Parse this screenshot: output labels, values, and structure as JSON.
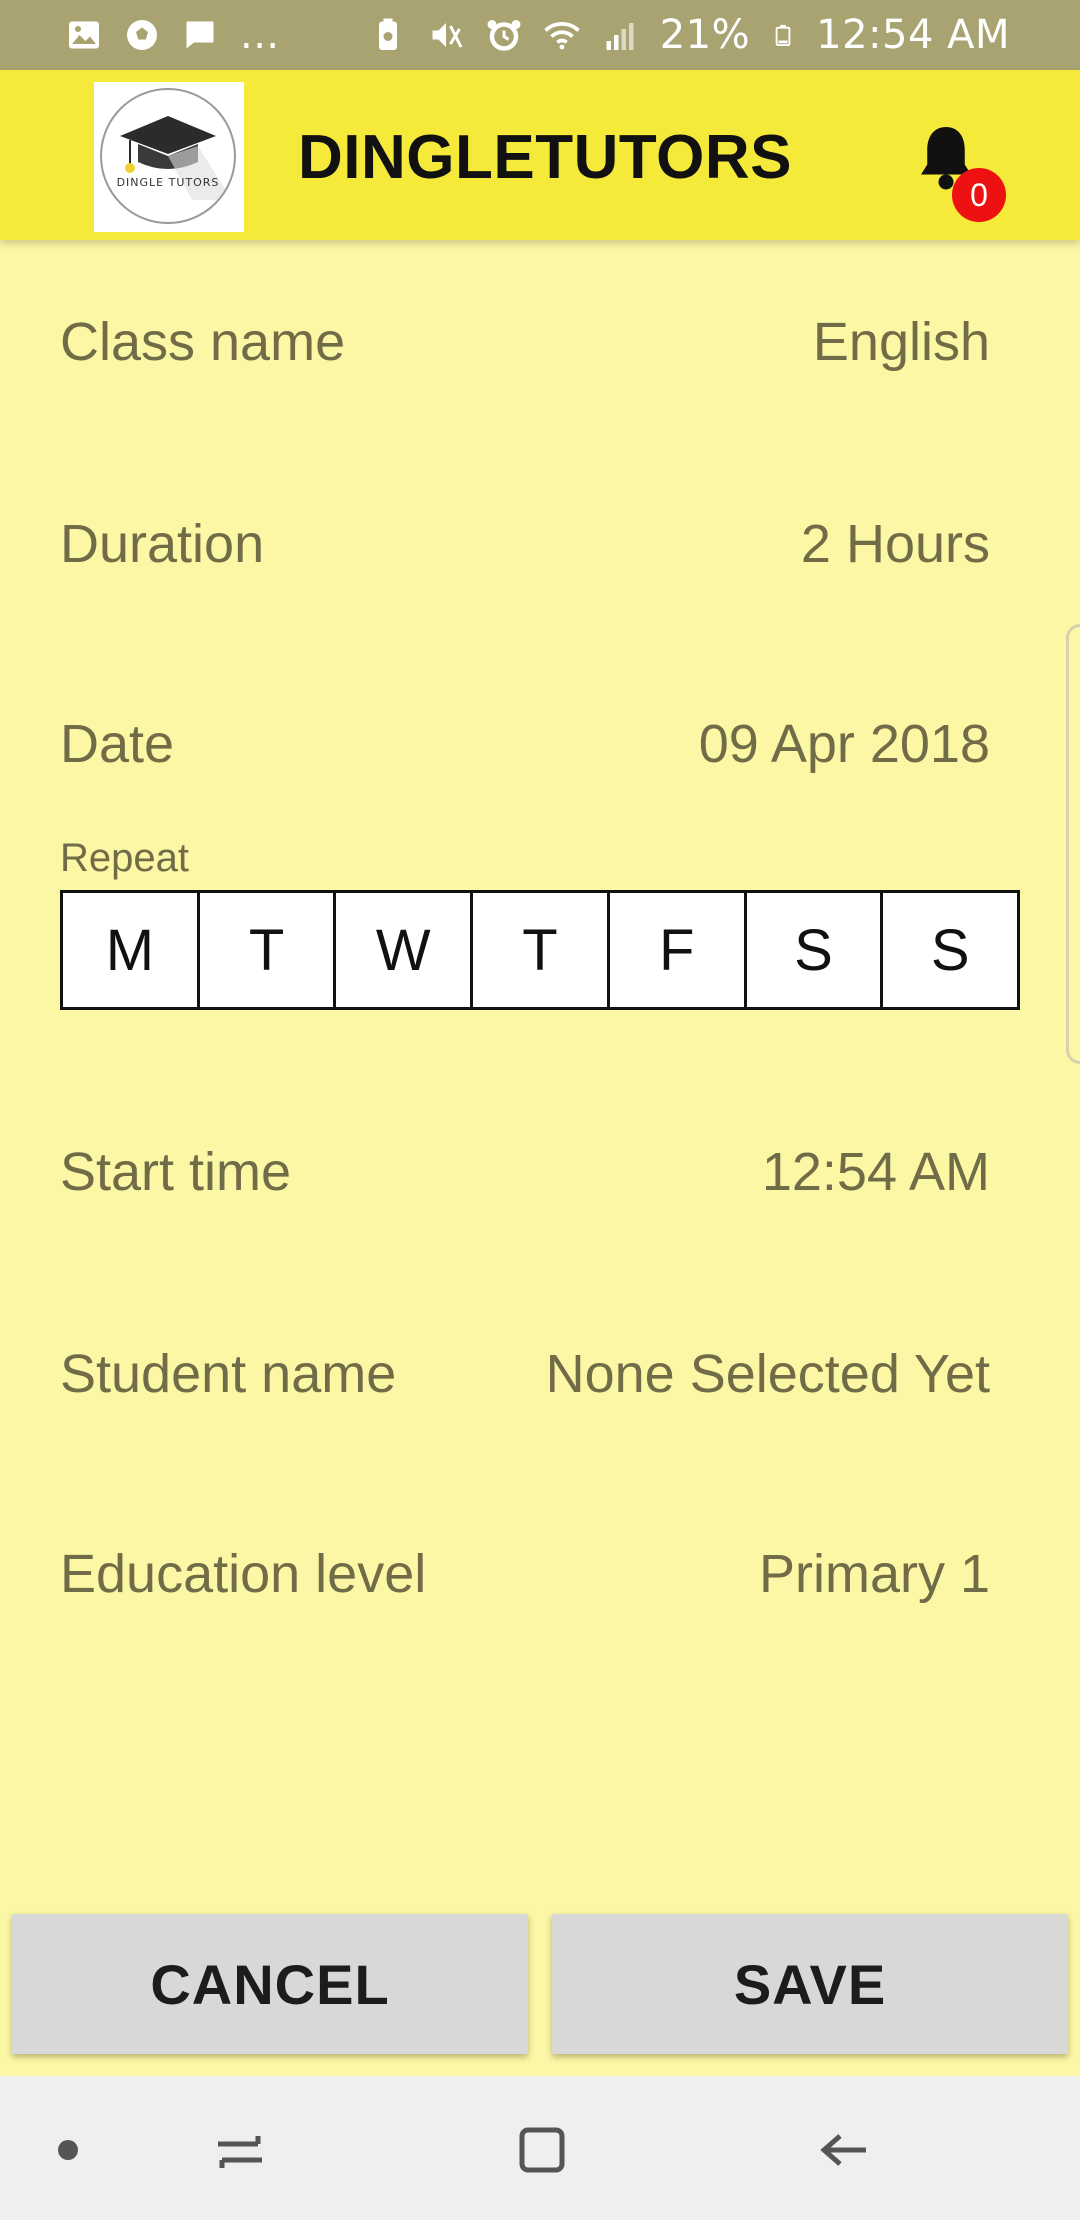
{
  "status_bar": {
    "notification_icons": [
      "image-icon",
      "soccer-ball-icon",
      "message-icon"
    ],
    "overflow": "...",
    "battery_percent": "21%",
    "time": "12:54 AM"
  },
  "app_bar": {
    "logo_text": "DINGLE TUTORS",
    "title": "DINGLETUTORS",
    "notification_count": "0"
  },
  "form": {
    "class_name": {
      "label": "Class name",
      "value": "English"
    },
    "duration": {
      "label": "Duration",
      "value": "2 Hours"
    },
    "date": {
      "label": "Date",
      "value": "09 Apr 2018"
    },
    "repeat": {
      "label": "Repeat",
      "days": [
        "M",
        "T",
        "W",
        "T",
        "F",
        "S",
        "S"
      ]
    },
    "start_time": {
      "label": "Start time",
      "value": "12:54 AM"
    },
    "student_name": {
      "label": "Student name",
      "value": "None Selected Yet"
    },
    "education_level": {
      "label": "Education level",
      "value": "Primary 1"
    }
  },
  "actions": {
    "cancel_label": "CANCEL",
    "save_label": "SAVE"
  },
  "colors": {
    "status_bar": "#a8a370",
    "app_bar": "#f5e93a",
    "background": "#fcf7a4",
    "text": "#706c48",
    "badge": "#ee1111",
    "button": "#d8d8d6"
  }
}
